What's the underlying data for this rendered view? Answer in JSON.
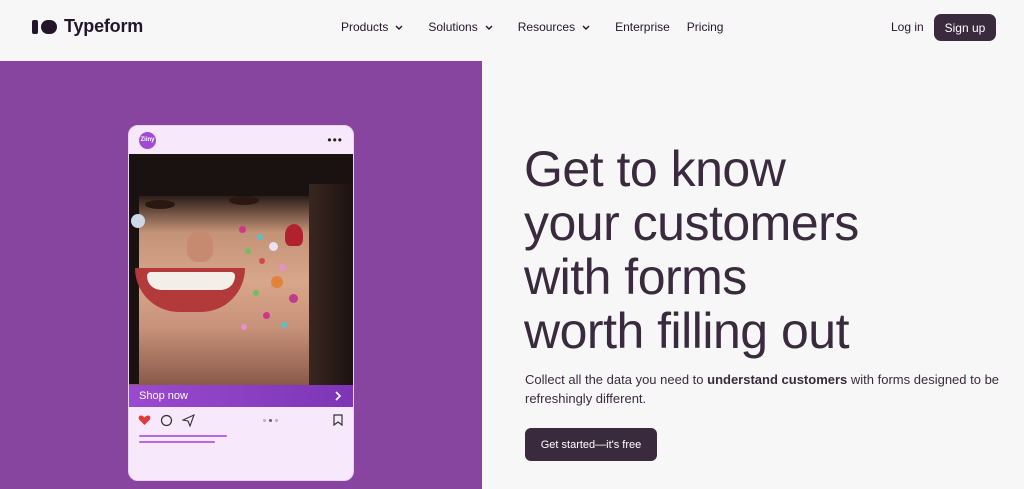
{
  "header": {
    "logo_text": "Typeform",
    "nav": [
      "Products",
      "Solutions",
      "Resources",
      "Enterprise",
      "Pricing"
    ],
    "login": "Log in",
    "signup": "Sign up"
  },
  "phone_card": {
    "avatar_text": "Ziiny",
    "menu_icon": "more-dots-icon",
    "shop_label": "Shop now",
    "icons": [
      "heart-icon",
      "comment-icon",
      "send-icon",
      "bookmark-icon"
    ]
  },
  "hero": {
    "headline_lines": [
      "Get to know",
      "your customers",
      "with forms",
      "worth filling out"
    ],
    "sub_before": "Collect all the data you need to ",
    "sub_bold": "understand customers",
    "sub_after": " with forms designed to be refreshingly different.",
    "cta": "Get started—it's free"
  },
  "colors": {
    "panel": "#88459f",
    "dark": "#3a2a3d",
    "background": "#f7f7f8"
  }
}
